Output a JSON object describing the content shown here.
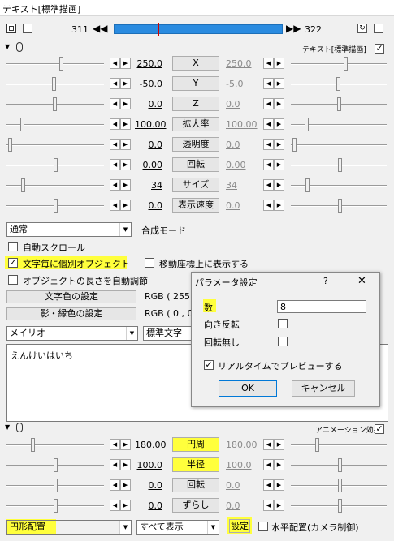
{
  "window": {
    "title": "テキスト[標準描画]"
  },
  "timeline": {
    "start": "311",
    "end": "322",
    "prev_icon": "◀◀",
    "next_icon": "▶▶"
  },
  "text_section": {
    "header_label": "テキスト[標準描画]"
  },
  "tracks": [
    {
      "name": "X",
      "value": "250.0",
      "end_value": "250.0"
    },
    {
      "name": "Y",
      "value": "-50.0",
      "end_value": "-5.0"
    },
    {
      "name": "Z",
      "value": "0.0",
      "end_value": "0.0"
    },
    {
      "name": "拡大率",
      "value": "100.00",
      "end_value": "100.00"
    },
    {
      "name": "透明度",
      "value": "0.0",
      "end_value": "0.0"
    },
    {
      "name": "回転",
      "value": "0.00",
      "end_value": "0.00"
    },
    {
      "name": "サイズ",
      "value": "34",
      "end_value": "34"
    },
    {
      "name": "表示速度",
      "value": "0.0",
      "end_value": "0.0"
    }
  ],
  "blend": {
    "value": "通常",
    "label": "合成モード"
  },
  "options": {
    "auto_scroll": "自動スクロール",
    "per_char": "文字毎に個別オブジェクト",
    "show_on_coords": "移動座標上に表示する",
    "auto_length": "オブジェクトの長さを自動調節"
  },
  "colors": {
    "text_color_btn": "文字色の設定",
    "text_color_value": "RGB ( 255 ,",
    "shadow_color_btn": "影・縁色の設定",
    "shadow_color_value": "RGB ( 0 , 0"
  },
  "font": {
    "name": "メイリオ",
    "style": "標準文字"
  },
  "text_content": "えんけいはいち",
  "anim_section": {
    "header_label": "アニメーション効果"
  },
  "anim_tracks": [
    {
      "name": "円周",
      "value": "180.00",
      "end_value": "180.00"
    },
    {
      "name": "半径",
      "value": "100.0",
      "end_value": "100.0"
    },
    {
      "name": "回転",
      "value": "0.0",
      "end_value": "0.0"
    },
    {
      "name": "ずらし",
      "value": "0.0",
      "end_value": "0.0"
    }
  ],
  "bottom": {
    "effect": "円形配置",
    "display": "すべて表示",
    "settings_btn": "設定",
    "camera_label": "水平配置(カメラ制御)"
  },
  "dialog": {
    "title": "パラメータ設定",
    "help": "?",
    "close": "✕",
    "count_label": "数",
    "count_value": "8",
    "reverse_label": "向き反転",
    "no_rotate_label": "回転無し",
    "preview_label": "リアルタイムでプレビューする",
    "ok": "OK",
    "cancel": "キャンセル"
  },
  "accent_color": "#2a8be0",
  "highlight_color": "#ffff3c"
}
